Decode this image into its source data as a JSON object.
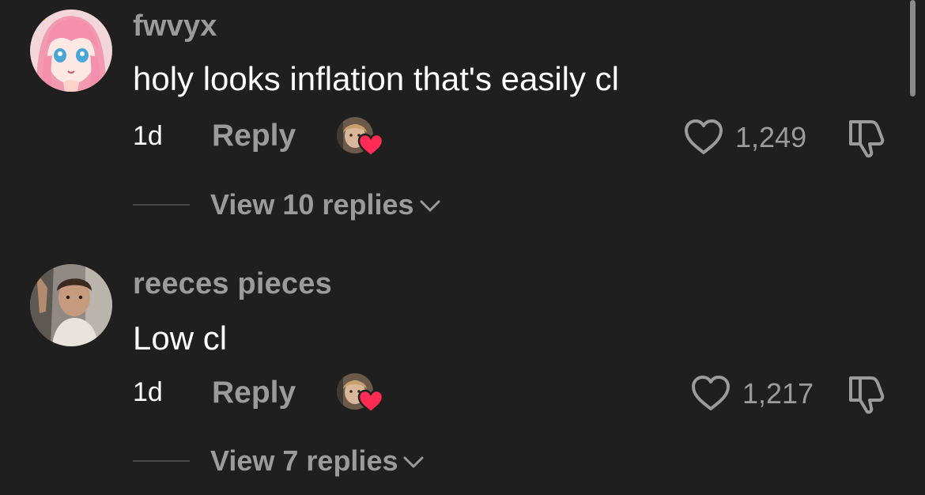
{
  "comments": [
    {
      "username": "fwvyx",
      "text": "holy looks inflation that's easily cl",
      "time": "1d",
      "reply_label": "Reply",
      "like_count": "1,249",
      "view_replies": "View 10 replies",
      "avatar": "anime-girl-pink-hair-icon"
    },
    {
      "username": "reeces pieces",
      "text": "Low cl",
      "time": "1d",
      "reply_label": "Reply",
      "like_count": "1,217",
      "view_replies": "View 7 replies",
      "avatar": "man-photo-avatar"
    }
  ],
  "colors": {
    "background": "#1f1f1f",
    "muted_text": "#9b9b9b",
    "primary_text": "#ffffff",
    "creator_heart": "#fe2c55"
  }
}
